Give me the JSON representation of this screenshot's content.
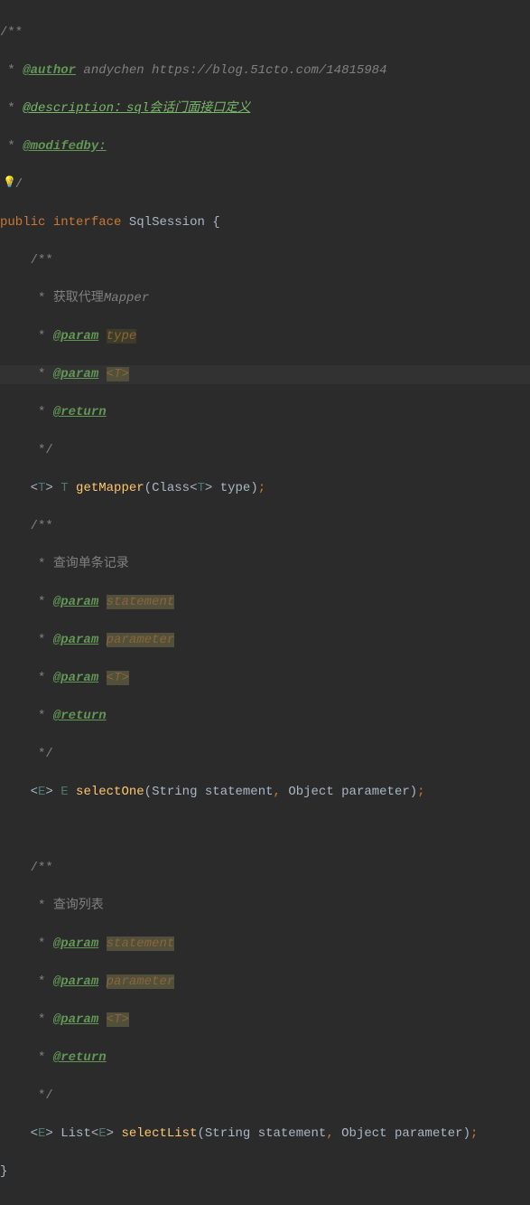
{
  "lines": {
    "l1": "/**",
    "l2_star": " * ",
    "l2_tag": "@author",
    "l2_text": " andychen https://blog.51cto.com/14815984",
    "l3_star": " * ",
    "l3_tag": "@description：",
    "l3_text_italic": "sql",
    "l3_text_cn": "会话门面接口定义",
    "l4_star": " * ",
    "l4_tag": "@modifedby:",
    "l5": " */",
    "l6_kw1": "public",
    "l6_kw2": "interface",
    "l6_name": "SqlSession",
    "l6_brace": " {",
    "l7": "    /**",
    "l8_star": "     * ",
    "l8_cn": "获取代理",
    "l8_it": "Mapper",
    "l9_star": "     * ",
    "l9_tag": "@param",
    "l9_sp": " ",
    "l9_name": "type",
    "l10_star": "     * ",
    "l10_tag": "@param",
    "l10_sp": " ",
    "l10_name": "<T>",
    "l11_star": "     * ",
    "l11_tag": "@return",
    "l12": "     */",
    "l13_indent": "    ",
    "l13_a1": "<",
    "l13_tp": "T",
    "l13_a2": "> ",
    "l13_tp2": "T",
    "l13_sp": " ",
    "l13_method": "getMapper",
    "l13_p1": "(",
    "l13_cls": "Class",
    "l13_a3": "<",
    "l13_tp3": "T",
    "l13_a4": "> ",
    "l13_arg": "type",
    "l13_p2": ")",
    "l13_semi": ";",
    "l14": "    /**",
    "l15_star": "     * ",
    "l15_cn": "查询单条记录",
    "l16_star": "     * ",
    "l16_tag": "@param",
    "l16_sp": " ",
    "l16_name": "statement",
    "l17_star": "     * ",
    "l17_tag": "@param",
    "l17_sp": " ",
    "l17_name": "parameter",
    "l18_star": "     * ",
    "l18_tag": "@param",
    "l18_sp": " ",
    "l18_name": "<T>",
    "l19_star": "     * ",
    "l19_tag": "@return",
    "l20": "     */",
    "l21_indent": "    ",
    "l21_a1": "<",
    "l21_tp": "E",
    "l21_a2": "> ",
    "l21_tp2": "E",
    "l21_sp": " ",
    "l21_method": "selectOne",
    "l21_p1": "(",
    "l21_cls": "String ",
    "l21_arg1": "statement",
    "l21_comma": ",",
    "l21_sp2": " ",
    "l21_cls2": "Object ",
    "l21_arg2": "parameter",
    "l21_p2": ")",
    "l21_semi": ";",
    "l22": "",
    "l23": "    /**",
    "l24_star": "     * ",
    "l24_cn": "查询列表",
    "l25_star": "     * ",
    "l25_tag": "@param",
    "l25_sp": " ",
    "l25_name": "statement",
    "l26_star": "     * ",
    "l26_tag": "@param",
    "l26_sp": " ",
    "l26_name": "parameter",
    "l27_star": "     * ",
    "l27_tag": "@param",
    "l27_sp": " ",
    "l27_name": "<T>",
    "l28_star": "     * ",
    "l28_tag": "@return",
    "l29": "     */",
    "l30_indent": "    ",
    "l30_a1": "<",
    "l30_tp": "E",
    "l30_a2": "> ",
    "l30_list": "List",
    "l30_a3": "<",
    "l30_tp2": "E",
    "l30_a4": "> ",
    "l30_method": "selectList",
    "l30_p1": "(",
    "l30_cls": "String ",
    "l30_arg1": "statement",
    "l30_comma": ",",
    "l30_sp2": " ",
    "l30_cls2": "Object ",
    "l30_arg2": "parameter",
    "l30_p2": ")",
    "l30_semi": ";",
    "l31": "}"
  },
  "icons": {
    "bulb": "💡"
  }
}
